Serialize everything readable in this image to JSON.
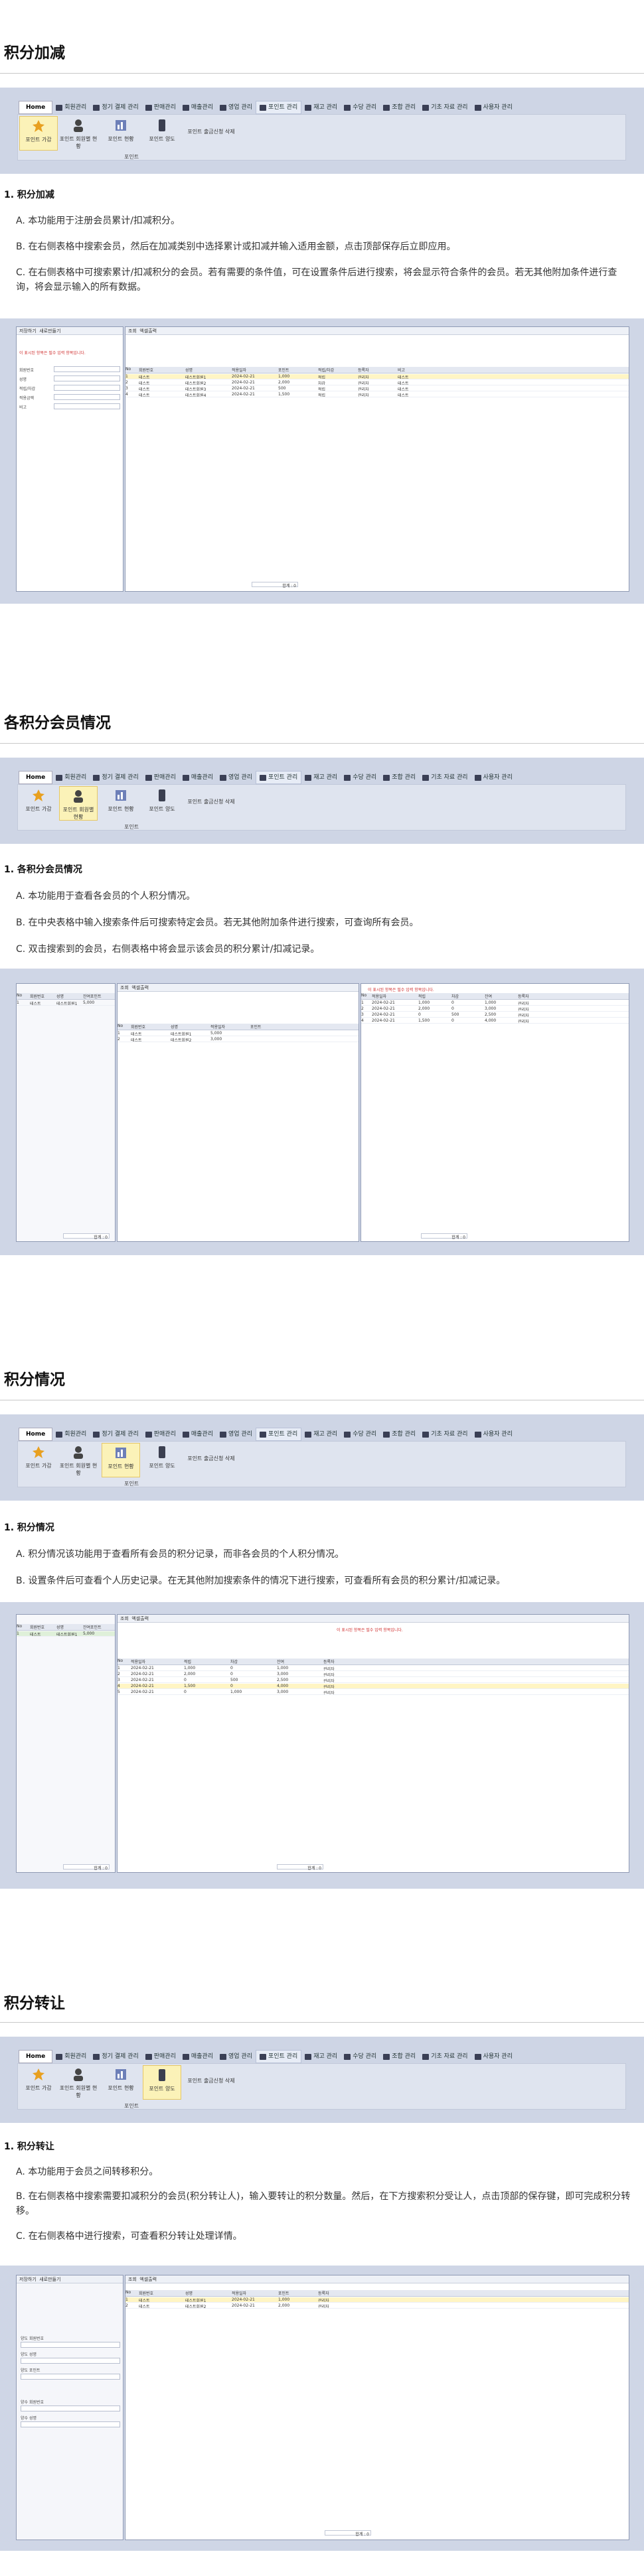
{
  "ribbon": {
    "tabs": [
      "Home",
      "회원관리",
      "정기 결제 관리",
      "판매관리",
      "매출관리",
      "영업 관리",
      "포인트 관리",
      "재고 관리",
      "수당 관리",
      "조합 관리",
      "기초 자료 관리",
      "사용자 관리"
    ],
    "buttons": [
      "포인트 가감",
      "포인트 회원별 현황",
      "포인트 현황",
      "포인트 양도",
      "포인트 출금신청 삭제"
    ],
    "group_label": "포인트"
  },
  "sections": [
    {
      "title": "积分加减",
      "subheading": "1. 积分加减",
      "paragraphs": [
        "A. 本功能用于注册会员累计/扣减积分。",
        "B. 在右侧表格中搜索会员，然后在加减类别中选择累计或扣减并输入适用金额，点击顶部保存后立即应用。",
        "C. 在右侧表格中可搜索累计/扣减积分的会员。若有需要的条件值，可在设置条件后进行搜索，将会显示符合条件的会员。若无其他附加条件进行查询，将会显示输入的所有数据。"
      ]
    },
    {
      "title": "各积分会员情况",
      "subheading": "1. 各积分会员情况",
      "paragraphs": [
        "A. 本功能用于查看各会员的个人积分情况。",
        "B. 在中央表格中输入搜索条件后可搜索特定会员。若无其他附加条件进行搜索，可查询所有会员。",
        "C. 双击搜索到的会员，右侧表格中将会显示该会员的积分累计/扣减记录。"
      ]
    },
    {
      "title": "积分情况",
      "subheading": "1. 积分情况",
      "paragraphs": [
        "A. 积分情况该功能用于查看所有会员的积分记录，而非各会员的个人积分情况。",
        "B. 设置条件后可查看个人历史记录。在无其他附加搜索条件的情况下进行搜索，可查看所有会员的积分累计/扣减记录。"
      ]
    },
    {
      "title": "积分转让",
      "subheading": "1. 积分转让",
      "paragraphs": [
        "A. 本功能用于会员之间转移积分。",
        "B. 在右侧表格中搜索需要扣减积分的会员(积分转让人)，输入要转让的积分数量。然后，在下方搜索积分受让人，点击顶部的保存键，即可完成积分转移。",
        "C. 在右侧表格中进行搜索，可查看积分转让处理详情。"
      ]
    }
  ],
  "app": {
    "toolbar": [
      "저장하기",
      "새로만들기",
      "조회",
      "엑셀출력"
    ],
    "warning": "이 표시된 항목은 필수 입력 항목입니다.",
    "left_labels": [
      "회원번호",
      "성명",
      "적립/차감",
      "적용금액",
      "비고"
    ],
    "grid_headers": [
      "No",
      "회원번호",
      "성명",
      "적용일자",
      "포인트",
      "적립/차감",
      "등록자",
      "비고"
    ],
    "rows": [
      [
        "1",
        "테스트",
        "테스트회원1",
        "2024-02-21",
        "1,000",
        "적립",
        "관리자",
        "테스트"
      ],
      [
        "2",
        "테스트",
        "테스트회원2",
        "2024-02-21",
        "2,000",
        "차감",
        "관리자",
        "테스트"
      ],
      [
        "3",
        "테스트",
        "테스트회원3",
        "2024-02-21",
        "500",
        "적립",
        "관리자",
        "테스트"
      ],
      [
        "4",
        "테스트",
        "테스트회원4",
        "2024-02-21",
        "1,500",
        "적립",
        "관리자",
        "테스트"
      ]
    ],
    "member_headers": [
      "No",
      "회원번호",
      "성명",
      "잔여포인트"
    ],
    "member_rows": [
      [
        "1",
        "테스트",
        "테스트회원1",
        "5,000"
      ],
      [
        "2",
        "테스트",
        "테스트회원2",
        "3,000"
      ]
    ],
    "history_headers": [
      "No",
      "적용일자",
      "적립",
      "차감",
      "잔여",
      "등록자"
    ],
    "history_rows": [
      [
        "1",
        "2024-02-21",
        "1,000",
        "0",
        "1,000",
        "관리자"
      ],
      [
        "2",
        "2024-02-21",
        "2,000",
        "0",
        "3,000",
        "관리자"
      ],
      [
        "3",
        "2024-02-21",
        "0",
        "500",
        "2,500",
        "관리자"
      ],
      [
        "4",
        "2024-02-21",
        "1,500",
        "0",
        "4,000",
        "관리자"
      ],
      [
        "5",
        "2024-02-21",
        "0",
        "1,000",
        "3,000",
        "관리자"
      ],
      [
        "6",
        "2024-02-21",
        "2,000",
        "0",
        "5,000",
        "관리자"
      ],
      [
        "7",
        "2024-02-21",
        "0",
        "0",
        "5,000",
        "관리자"
      ]
    ],
    "transfer_labels": [
      "양도 회원번호",
      "양도 성명",
      "양도 포인트",
      "양수 회원번호",
      "양수 성명"
    ],
    "footer_total": "합계 : 0"
  }
}
